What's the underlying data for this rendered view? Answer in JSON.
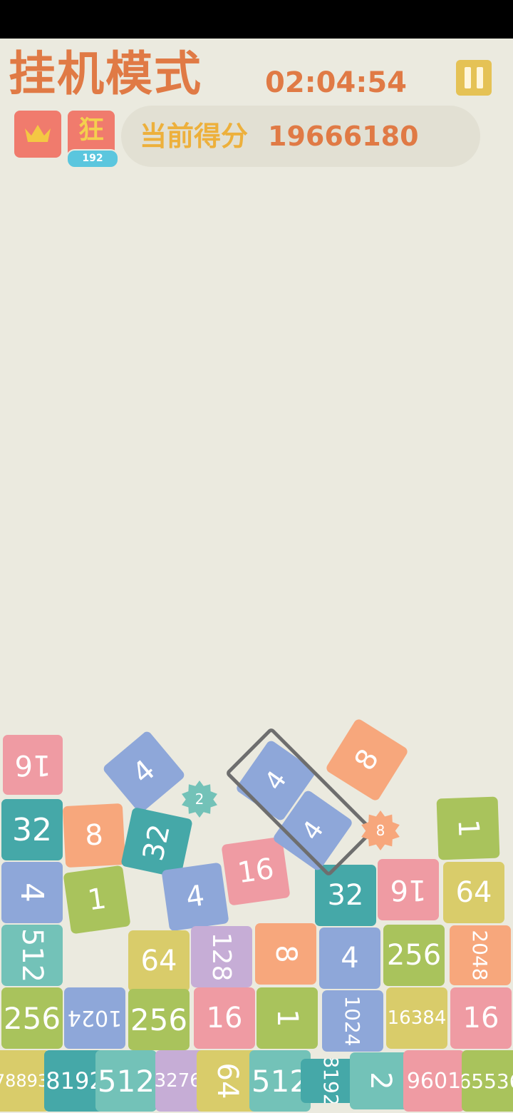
{
  "header": {
    "title": "挂机模式",
    "timer": "02:04:54",
    "score_label": "当前得分",
    "score_value": "19666180",
    "mode_glyph": "狂",
    "mode_badge": "192",
    "icons": [
      "crown-icon",
      "pause-icon"
    ]
  },
  "colors": {
    "background": "#EBEADF",
    "accent_orange": "#E07A45",
    "accent_yellow": "#EDB03C",
    "pink": "#EF9BA3",
    "teal_dark": "#45A8A8",
    "teal_light": "#73C2B8",
    "blue": "#8EA7D9",
    "green": "#A9C35C",
    "olive_yellow": "#D9CC6A",
    "peach": "#F7A77C",
    "lavender": "#C6ADD6"
  },
  "tiles": [
    {
      "text": "16",
      "color": "#EF9BA3"
    },
    {
      "text": "32",
      "color": "#45A8A8"
    },
    {
      "text": "4",
      "color": "#8EA7D9"
    },
    {
      "text": "512",
      "color": "#73C2B8"
    },
    {
      "text": "256",
      "color": "#A9C35C"
    },
    {
      "text": "4",
      "color": "#8EA7D9"
    },
    {
      "text": "8",
      "color": "#F7A77C"
    },
    {
      "text": "1",
      "color": "#A9C35C"
    },
    {
      "text": "32",
      "color": "#45A8A8"
    },
    {
      "text": "4",
      "color": "#8EA7D9"
    },
    {
      "text": "16",
      "color": "#EF9BA3"
    },
    {
      "text": "1024",
      "color": "#8EA7D9"
    },
    {
      "text": "64",
      "color": "#D9CC6A"
    },
    {
      "text": "256",
      "color": "#A9C35C"
    },
    {
      "text": "128",
      "color": "#C6ADD6"
    },
    {
      "text": "8",
      "color": "#F7A77C"
    },
    {
      "text": "16",
      "color": "#EF9BA3"
    },
    {
      "text": "1",
      "color": "#A9C35C"
    },
    {
      "text": "32",
      "color": "#45A8A8"
    },
    {
      "text": "16",
      "color": "#EF9BA3"
    },
    {
      "text": "64",
      "color": "#D9CC6A"
    },
    {
      "text": "4",
      "color": "#8EA7D9"
    },
    {
      "text": "256",
      "color": "#A9C35C"
    },
    {
      "text": "2048",
      "color": "#F7A77C"
    },
    {
      "text": "1024",
      "color": "#8EA7D9"
    },
    {
      "text": "16384",
      "color": "#D9CC6A"
    },
    {
      "text": "16",
      "color": "#EF9BA3"
    },
    {
      "text": "1",
      "color": "#A9C35C"
    },
    {
      "text": "64",
      "color": "#D9CC6A"
    },
    {
      "text": "8",
      "color": "#F7A77C"
    },
    {
      "text": "4",
      "color": "#8EA7D9"
    },
    {
      "text": "4",
      "color": "#8EA7D9"
    },
    {
      "text": "78893",
      "color": "#D9CC6A"
    },
    {
      "text": "8192",
      "color": "#45A8A8"
    },
    {
      "text": "512",
      "color": "#73C2B8"
    },
    {
      "text": "32768",
      "color": "#C6ADD6"
    },
    {
      "text": "64",
      "color": "#D9CC6A"
    },
    {
      "text": "512",
      "color": "#73C2B8"
    },
    {
      "text": "8192",
      "color": "#45A8A8"
    },
    {
      "text": "2",
      "color": "#73C2B8"
    },
    {
      "text": "9601",
      "color": "#EF9BA3"
    },
    {
      "text": "65536",
      "color": "#A9C35C"
    }
  ],
  "gems": [
    {
      "text": "2",
      "color": "#73C2B8"
    },
    {
      "text": "8",
      "color": "#F7A77C"
    }
  ]
}
